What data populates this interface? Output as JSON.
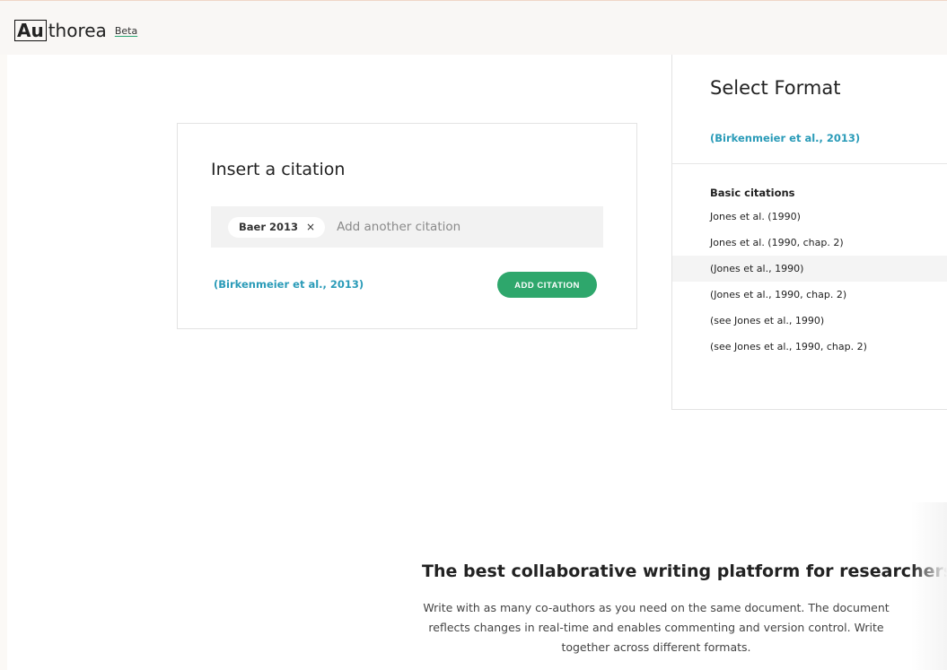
{
  "header": {
    "logo_boxed": "Au",
    "logo_rest": "thorea",
    "beta_label": "Beta"
  },
  "insert_citation": {
    "title": "Insert a citation",
    "chip_label": "Baer 2013",
    "chip_remove_symbol": "×",
    "input_placeholder": "Add another citation",
    "preview": "(Birkenmeier et al., 2013)",
    "add_button_label": "ADD CITATION"
  },
  "select_format": {
    "title": "Select Format",
    "current": "(Birkenmeier et al., 2013)",
    "section_title": "Basic citations",
    "items": [
      "Jones et al. (1990)",
      "Jones et al. (1990, chap. 2)",
      "(Jones et al., 1990)",
      "(Jones et al., 1990, chap. 2)",
      "(see Jones et al., 1990)",
      "(see Jones et al., 1990, chap. 2)"
    ],
    "highlighted_index": 2
  },
  "promo": {
    "title": "The best collaborative writing platform for researchers",
    "text": "Write with as many co-authors as you need on the same document. The document reflects changes in real-time and enables commenting and version control. Write together across different formats."
  },
  "colors": {
    "accent_green": "#2ea76c",
    "link_blue": "#2a9bb8"
  }
}
